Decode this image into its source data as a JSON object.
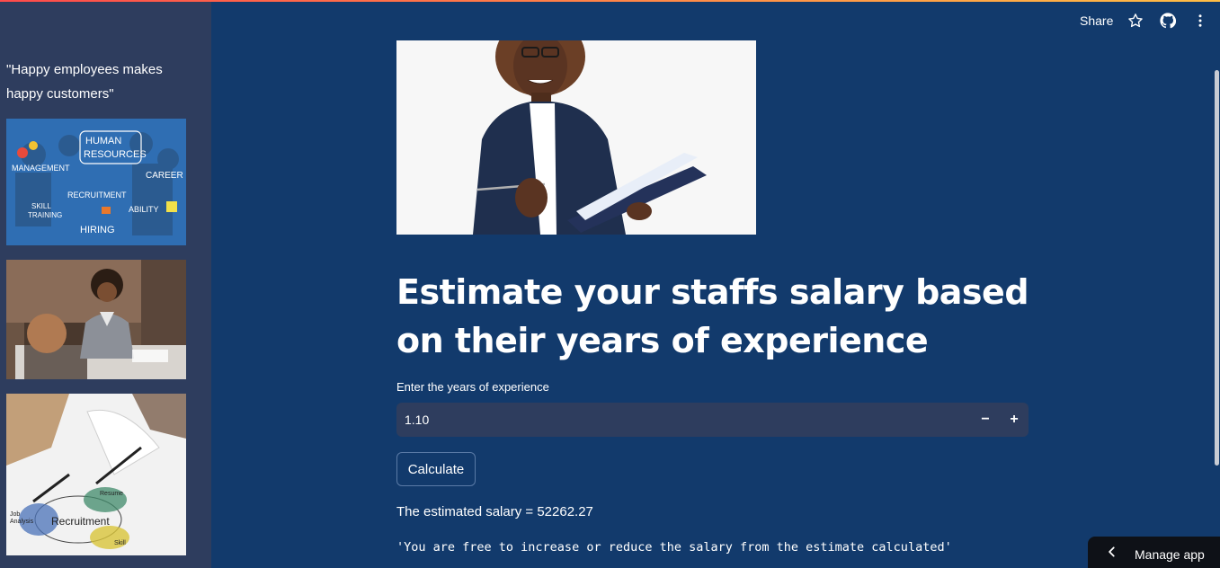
{
  "header": {
    "share_label": "Share",
    "icons": [
      "star-icon",
      "github-icon",
      "more-vertical-icon"
    ]
  },
  "sidebar": {
    "quote": "\"Happy employees makes happy customers\"",
    "image1": {
      "words": [
        "HUMAN",
        "RESOURCES",
        "MANAGEMENT",
        "CAREER",
        "RECRUITMENT",
        "SKILL",
        "TRAINING",
        "ABILITY",
        "HIRING"
      ]
    },
    "image3": {
      "words": [
        "Recruitment",
        "Resume",
        "Job",
        "Analysis",
        "Skill"
      ]
    }
  },
  "main": {
    "title": "Estimate your staffs salary based on their years of experience",
    "input_label": "Enter the years of experience",
    "input_value": "1.10",
    "minus_label": "−",
    "plus_label": "+",
    "calculate_label": "Calculate",
    "result_text": "The estimated salary = 52262.27",
    "note_text": "'You are free to increase or reduce the salary from the estimate calculated'"
  },
  "manage_app": {
    "label": "Manage app"
  },
  "colors": {
    "background": "#123a6c",
    "sidebar": "#2e3d5e",
    "input_bg": "#2e3d5e",
    "manage_bg": "#0e1117"
  }
}
